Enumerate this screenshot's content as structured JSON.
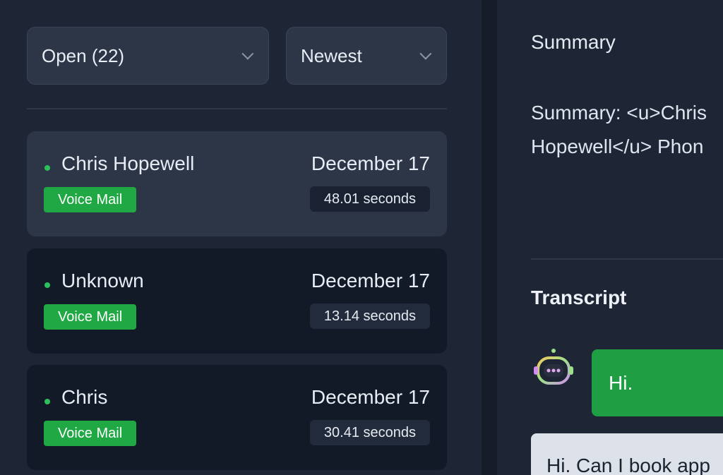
{
  "filters": {
    "status_label": "Open (22)",
    "sort_label": "Newest"
  },
  "calls": [
    {
      "name": "Chris Hopewell",
      "date": "December 17",
      "type": "Voice Mail",
      "duration": "48.01 seconds"
    },
    {
      "name": "Unknown",
      "date": "December 17",
      "type": "Voice Mail",
      "duration": "13.14 seconds"
    },
    {
      "name": "Chris",
      "date": "December 17",
      "type": "Voice Mail",
      "duration": "30.41 seconds"
    }
  ],
  "detail": {
    "summary_title": "Summary",
    "summary_line1": "Summary: <u>Chris",
    "summary_line2": "Hopewell</u> Phon",
    "transcript_title": "Transcript",
    "bot_message": "Hi.",
    "user_message": "Hi. Can I book app"
  },
  "icons": {
    "status_chevron": "chevron-down-icon",
    "sort_chevron": "chevron-down-icon",
    "avatar": "robot-icon"
  },
  "colors": {
    "accent_green": "#1fa844",
    "online_dot": "#2bc05a",
    "panel_bg": "#1e2635",
    "card_active_bg": "#2c3647",
    "card_bg": "#131a27"
  }
}
